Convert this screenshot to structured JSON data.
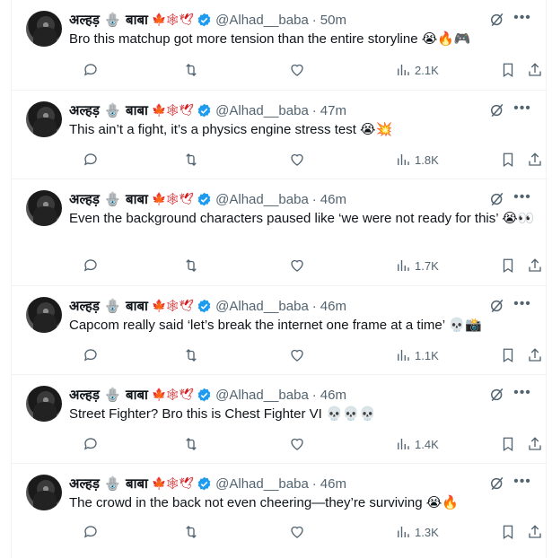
{
  "tweets": [
    {
      "name": "अल्हड़ 🪬 बाबा",
      "flags": "🍁🕸🕊",
      "handle": "@Alhad__baba",
      "time": "50m",
      "text": "Bro this matchup got more tension than the entire storyline 😭🔥🎮",
      "views": "2.1K"
    },
    {
      "name": "अल्हड़ 🪬 बाबा",
      "flags": "🍁🕸🕊",
      "handle": "@Alhad__baba",
      "time": "47m",
      "text": "This ain’t a fight, it’s a physics engine stress test 😭💥",
      "views": "1.8K"
    },
    {
      "name": "अल्हड़ 🪬 बाबा",
      "flags": "🍁🕸🕊",
      "handle": "@Alhad__baba",
      "time": "46m",
      "text": "Even the background characters paused like ‘we were not ready for this’ 😭👀",
      "views": "1.7K"
    },
    {
      "name": "अल्हड़ 🪬 बाबा",
      "flags": "🍁🕸🕊",
      "handle": "@Alhad__baba",
      "time": "46m",
      "text": "Capcom really said ‘let’s break the internet one frame at a time’ 💀📸",
      "views": "1.1K"
    },
    {
      "name": "अल्हड़ 🪬 बाबा",
      "flags": "🍁🕸🕊",
      "handle": "@Alhad__baba",
      "time": "46m",
      "text": "Street Fighter? Bro this is Chest Fighter VI 💀💀💀",
      "views": "1.4K"
    },
    {
      "name": "अल्हड़ 🪬 बाबा",
      "flags": "🍁🕸🕊",
      "handle": "@Alhad__baba",
      "time": "46m",
      "text": "The crowd in the back not even cheering—they’re surviving 😭🔥",
      "views": "1.3K"
    }
  ],
  "icons": {
    "reply": "reply-icon",
    "repost": "repost-icon",
    "like": "like-icon",
    "views": "views-icon",
    "bookmark": "bookmark-icon",
    "share": "share-icon",
    "grok": "grok-icon",
    "more": "more-icon",
    "verified": "verified-badge-icon"
  },
  "colors": {
    "text": "#0f1419",
    "secondary": "#536471",
    "verified": "#1d9bf0",
    "divider": "#eff3f4"
  }
}
